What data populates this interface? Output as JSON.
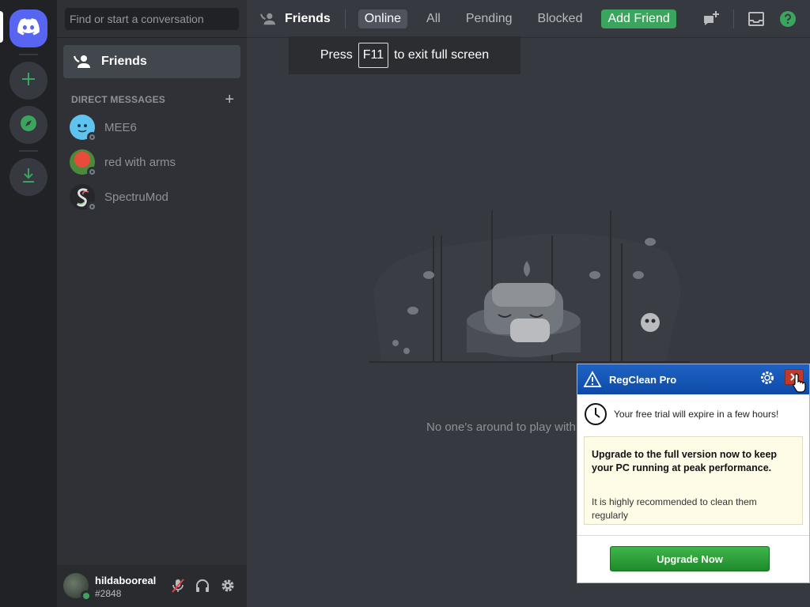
{
  "servers": {
    "home_label": "Home",
    "add_label": "Add a Server",
    "explore_label": "Explore Public Servers",
    "download_label": "Download Apps"
  },
  "sidebar": {
    "search_placeholder": "Find or start a conversation",
    "friends_label": "Friends",
    "dm_header": "DIRECT MESSAGES",
    "dm_add": "+",
    "dms": [
      {
        "name": "MEE6"
      },
      {
        "name": "red with arms"
      },
      {
        "name": "SpectruMod"
      }
    ]
  },
  "user": {
    "username": "hildabooreal",
    "tag": "#2848"
  },
  "topbar": {
    "title": "Friends",
    "tabs": [
      "Online",
      "All",
      "Pending",
      "Blocked"
    ],
    "add_friend": "Add Friend"
  },
  "fullscreen": {
    "prefix": "Press",
    "key": "F11",
    "suffix": "to exit full screen"
  },
  "empty_state": {
    "text": "No one's around to play with"
  },
  "popup": {
    "title": "RegClean Pro",
    "trial_text": "Your free trial will expire in a few hours!",
    "headline": "Upgrade to the full version now to keep your PC running at peak performance.",
    "note": "It is highly recommended to clean them regularly",
    "button": "Upgrade Now"
  },
  "colors": {
    "blurple": "#5865f2",
    "green": "#3ba55d",
    "popup_blue": "#1e63c4",
    "close_red": "#c0392b"
  }
}
